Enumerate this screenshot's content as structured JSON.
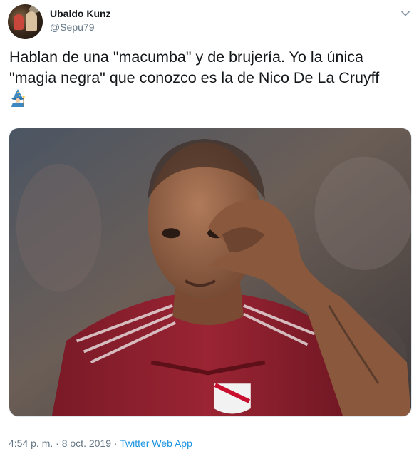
{
  "user": {
    "display_name": "Ubaldo Kunz",
    "handle": "@Sepu79"
  },
  "tweet": {
    "text": "Hablan de una \"macumba\" y de brujería. Yo la única \"magia negra\" que conozco es la de Nico De La Cruyff",
    "emoji": "mage-emoji"
  },
  "media": {
    "description_icon": "photo-player-heart-hands"
  },
  "meta": {
    "time": "4:54 p. m.",
    "separator": " · ",
    "date": "8 oct. 2019",
    "source": "Twitter Web App"
  },
  "colors": {
    "text": "#14171a",
    "secondary": "#657786",
    "link": "#1b95e0",
    "jersey": "#8e1f2e"
  }
}
